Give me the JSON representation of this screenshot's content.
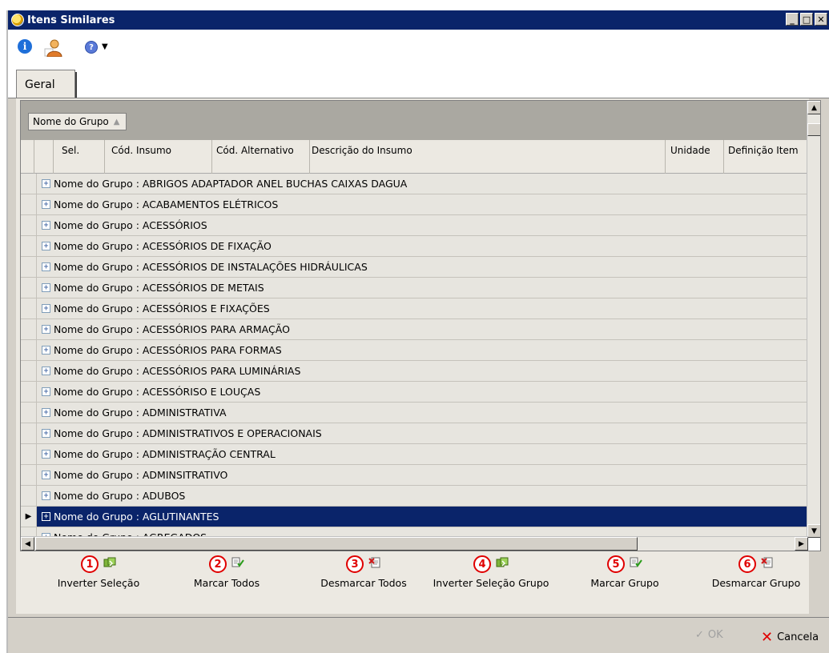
{
  "window": {
    "title": "Itens Similares"
  },
  "toolbar": {
    "info_glyph": "i",
    "help_glyph": "?",
    "dropdown_glyph": "▼"
  },
  "tabs": [
    {
      "label": "Geral"
    }
  ],
  "grid": {
    "group_by": {
      "label": "Nome do Grupo",
      "sort_glyph": "▲"
    },
    "columns": [
      "Sel.",
      "Cód. Insumo",
      "Cód. Alternativo",
      "Descrição do Insumo",
      "Unidade",
      "Definição Item"
    ],
    "rows": [
      "Nome do Grupo : ABRIGOS ADAPTADOR ANEL BUCHAS CAIXAS DAGUA",
      "Nome do Grupo : ACABAMENTOS ELÉTRICOS",
      "Nome do Grupo : ACESSÓRIOS",
      "Nome do Grupo : ACESSÓRIOS DE FIXAÇÃO",
      "Nome do Grupo : ACESSÓRIOS DE INSTALAÇÕES HIDRÁULICAS",
      "Nome do Grupo : ACESSÓRIOS DE METAIS",
      "Nome do Grupo : ACESSÓRIOS E FIXAÇÕES",
      "Nome do Grupo : ACESSÓRIOS PARA ARMAÇÃO",
      "Nome do Grupo : ACESSÓRIOS PARA FORMAS",
      "Nome do Grupo : ACESSÓRIOS PARA LUMINÁRIAS",
      "Nome do Grupo : ACESSÓRISO E LOUÇAS",
      "Nome do Grupo : ADMINISTRATIVA",
      "Nome do Grupo : ADMINISTRATIVOS E OPERACIONAIS",
      "Nome do Grupo : ADMINISTRAÇÃO CENTRAL",
      "Nome do Grupo : ADMINSITRATIVO",
      "Nome do Grupo : ADUBOS",
      "Nome do Grupo : AGLUTINANTES",
      "Nome do Grupo : AGREGADOS"
    ],
    "selected_row": "Nome do Grupo : AGLUTINANTES",
    "expander_glyph": "+"
  },
  "actions": [
    {
      "num": "1",
      "label": "Inverter Seleção",
      "icon": "invert-selection-icon"
    },
    {
      "num": "2",
      "label": "Marcar Todos",
      "icon": "check-all-icon"
    },
    {
      "num": "3",
      "label": "Desmarcar Todos",
      "icon": "uncheck-all-icon"
    },
    {
      "num": "4",
      "label": "Inverter Seleção Grupo",
      "icon": "invert-selection-icon"
    },
    {
      "num": "5",
      "label": "Marcar Grupo",
      "icon": "check-all-icon"
    },
    {
      "num": "6",
      "label": "Desmarcar Grupo",
      "icon": "uncheck-all-icon"
    }
  ],
  "footer": {
    "ok_label": "OK",
    "cancel_label": "Cancela"
  },
  "colors": {
    "titlebar": "#0a246a",
    "selected_row": "#0a246a",
    "annotation_red": "#e00000"
  }
}
